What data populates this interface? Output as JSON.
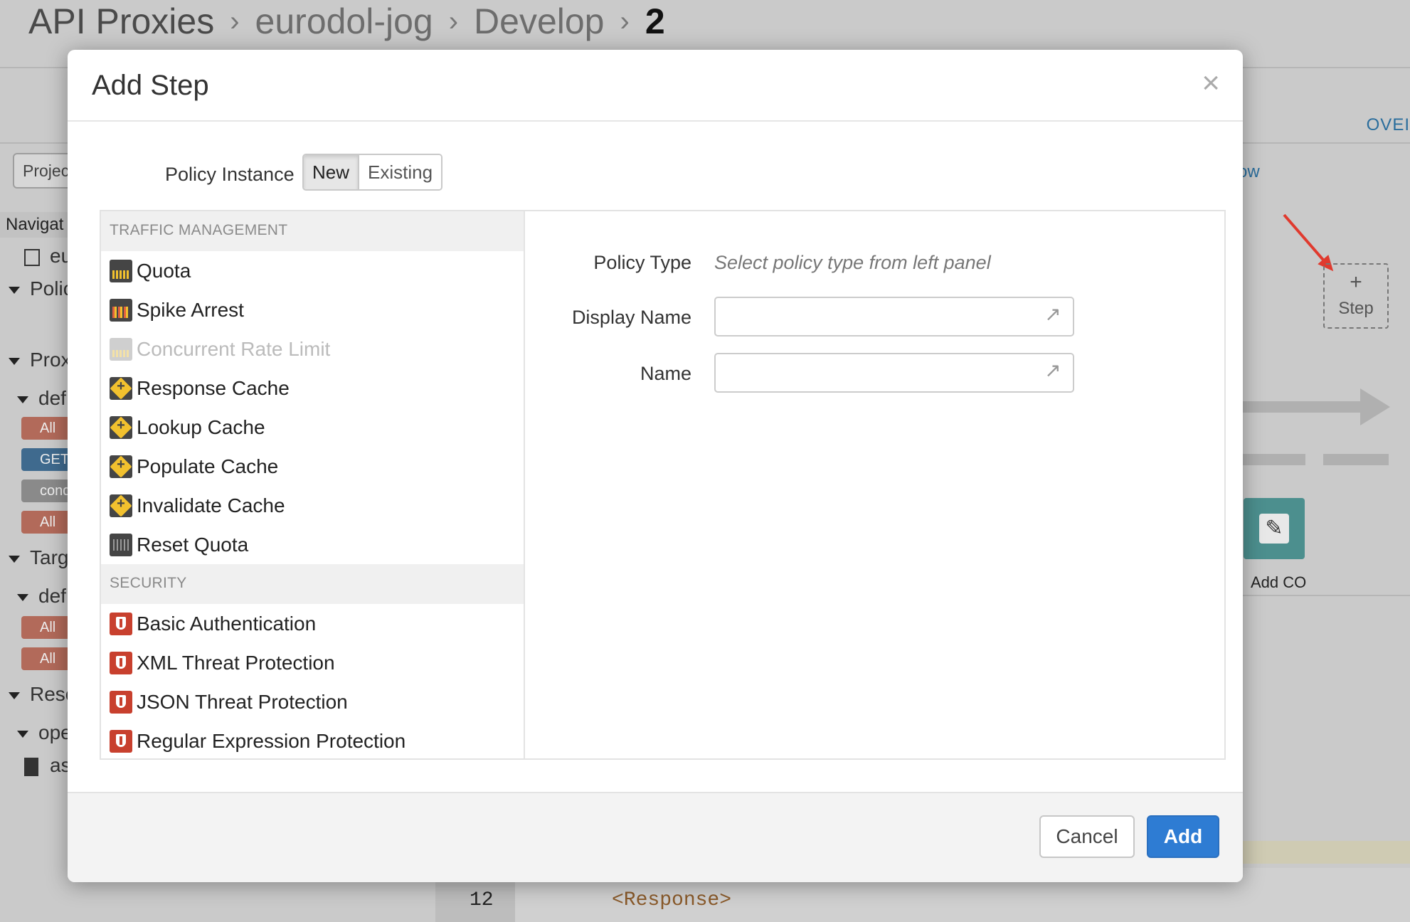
{
  "background": {
    "breadcrumb": [
      "API Proxies",
      "eurodol-jog",
      "Develop",
      "2"
    ],
    "project_button": "Projec",
    "overview_tab": "OVEI",
    "flow_link": "ow",
    "navigator": {
      "header": "Navigat",
      "rows": [
        "eu",
        "Polic",
        "Prox",
        "def",
        "Targ",
        "def",
        "Reso",
        "ope",
        "as"
      ],
      "pills": [
        "All",
        "GET",
        "cond",
        "All",
        "All",
        "All"
      ]
    },
    "step_box": {
      "plus": "+",
      "label": "Step"
    },
    "add_co_label": "Add CO",
    "code": {
      "line_number": "12",
      "text": "<Response>"
    }
  },
  "modal": {
    "title": "Add Step",
    "close": "×",
    "policy_instance": {
      "label": "Policy Instance",
      "options": [
        "New",
        "Existing"
      ],
      "selected": "New"
    },
    "categories": [
      {
        "name": "TRAFFIC MANAGEMENT",
        "items": [
          {
            "label": "Quota",
            "icon": "quota-icon",
            "enabled": true
          },
          {
            "label": "Spike Arrest",
            "icon": "spike-arrest-icon",
            "enabled": true
          },
          {
            "label": "Concurrent Rate Limit",
            "icon": "concurrent-rate-limit-icon",
            "enabled": false
          },
          {
            "label": "Response Cache",
            "icon": "cache-icon",
            "enabled": true
          },
          {
            "label": "Lookup Cache",
            "icon": "cache-icon",
            "enabled": true
          },
          {
            "label": "Populate Cache",
            "icon": "cache-icon",
            "enabled": true
          },
          {
            "label": "Invalidate Cache",
            "icon": "cache-icon",
            "enabled": true
          },
          {
            "label": "Reset Quota",
            "icon": "reset-quota-icon",
            "enabled": true
          }
        ]
      },
      {
        "name": "SECURITY",
        "items": [
          {
            "label": "Basic Authentication",
            "icon": "shield-icon",
            "enabled": true
          },
          {
            "label": "XML Threat Protection",
            "icon": "shield-icon",
            "enabled": true
          },
          {
            "label": "JSON Threat Protection",
            "icon": "shield-icon",
            "enabled": true
          },
          {
            "label": "Regular Expression Protection",
            "icon": "shield-icon",
            "enabled": true
          }
        ]
      }
    ],
    "form": {
      "policy_type_label": "Policy Type",
      "policy_type_hint": "Select policy type from left panel",
      "display_name_label": "Display Name",
      "display_name_value": "",
      "name_label": "Name",
      "name_value": ""
    },
    "buttons": {
      "cancel": "Cancel",
      "add": "Add"
    }
  },
  "colors": {
    "primary_button": "#2e7cd3",
    "security_icon": "#c8402e",
    "cache_icon": "#f2c12e",
    "annotation_arrow": "#e03a2e"
  }
}
